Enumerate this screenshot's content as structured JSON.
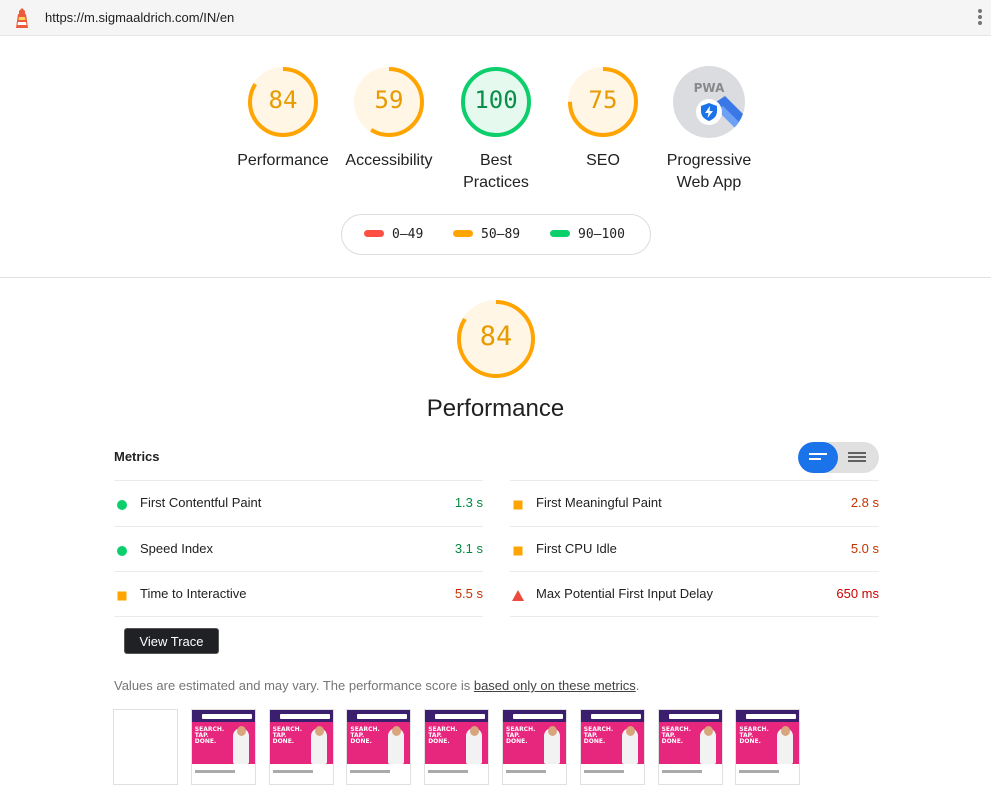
{
  "browser": {
    "url": "https://m.sigmaaldrich.com/IN/en",
    "logo_icon": "lighthouse-icon",
    "menu_icon": "kebab-menu-icon"
  },
  "colors": {
    "pass": "#0cce6b",
    "average": "#ffa400",
    "fail": "#ff4e42",
    "pwa": "#1a73e8"
  },
  "summary": {
    "gauges": [
      {
        "score": "84",
        "label": "Performance",
        "rating": "average",
        "fraction": 0.84
      },
      {
        "score": "59",
        "label": "Accessibility",
        "rating": "average",
        "fraction": 0.59
      },
      {
        "score": "100",
        "label": "Best Practices",
        "label_lines": [
          "Best",
          "Practices"
        ],
        "rating": "pass",
        "fraction": 1.0
      },
      {
        "score": "75",
        "label": "SEO",
        "rating": "average",
        "fraction": 0.75
      }
    ],
    "pwa": {
      "badge_text": "PWA",
      "label": "Progressive Web App",
      "label_lines": [
        "Progressive",
        "Web App"
      ],
      "icon": "pwa-fast-reliable-badge-icon"
    },
    "legend": [
      {
        "range": "0–49",
        "rating": "fail"
      },
      {
        "range": "50–89",
        "rating": "average"
      },
      {
        "range": "90–100",
        "rating": "pass"
      }
    ]
  },
  "performance": {
    "score": "84",
    "fraction": 0.84,
    "title": "Performance",
    "metrics_heading": "Metrics",
    "toggle_icons": [
      "metrics-compact-view-icon",
      "metrics-expanded-view-icon"
    ],
    "metrics": [
      {
        "name": "First Contentful Paint",
        "value": "1.3 s",
        "rating": "pass"
      },
      {
        "name": "First Meaningful Paint",
        "value": "2.8 s",
        "rating": "average"
      },
      {
        "name": "Speed Index",
        "value": "3.1 s",
        "rating": "pass"
      },
      {
        "name": "First CPU Idle",
        "value": "5.0 s",
        "rating": "average"
      },
      {
        "name": "Time to Interactive",
        "value": "5.5 s",
        "rating": "average"
      },
      {
        "name": "Max Potential First Input Delay",
        "value": "650 ms",
        "rating": "fail"
      }
    ],
    "view_trace_label": "View Trace",
    "note_prefix": "Values are estimated and may vary. The performance score is ",
    "note_link": "based only on these metrics",
    "note_suffix": ".",
    "filmstrip": {
      "frame_text_lines": [
        "SEARCH.",
        "TAP.",
        "DONE."
      ],
      "frames": [
        {
          "blank": true
        },
        {
          "blank": false
        },
        {
          "blank": false
        },
        {
          "blank": false
        },
        {
          "blank": false
        },
        {
          "blank": false
        },
        {
          "blank": false
        },
        {
          "blank": false
        },
        {
          "blank": false
        }
      ]
    }
  }
}
